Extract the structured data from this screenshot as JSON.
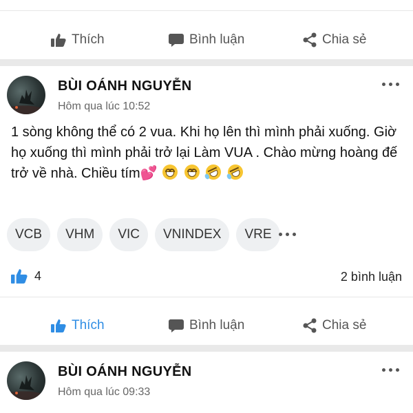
{
  "colors": {
    "accent": "#2f8de4",
    "muted": "#555555",
    "divider": "#e9e9e9"
  },
  "top_actions": {
    "like_label": "Thích",
    "comment_label": "Bình luận",
    "share_label": "Chia sẻ"
  },
  "post1": {
    "author": "BÙI OÁNH NGUYỄN",
    "time": "Hôm qua lúc 10:52",
    "text": "1 sòng không thể có 2 vua. Khi họ lên thì mình phải xuống. Giờ họ xuống thì mình phải trở lại Làm VUA . Chào mừng hoàng đế trở về nhà. Chiều tím",
    "emojis": [
      "heart-emoji",
      "grin-emoji",
      "grin-emoji",
      "rofl-emoji",
      "rofl-emoji"
    ],
    "tags": [
      "VCB",
      "VHM",
      "VIC",
      "VNINDEX",
      "VRE"
    ],
    "like_count": "4",
    "comment_count": "2 bình luận",
    "actions": {
      "like_label": "Thích",
      "comment_label": "Bình luận",
      "share_label": "Chia sẻ",
      "liked": true
    }
  },
  "post2": {
    "author": "BÙI OÁNH NGUYỄN",
    "time": "Hôm qua lúc 09:33"
  }
}
